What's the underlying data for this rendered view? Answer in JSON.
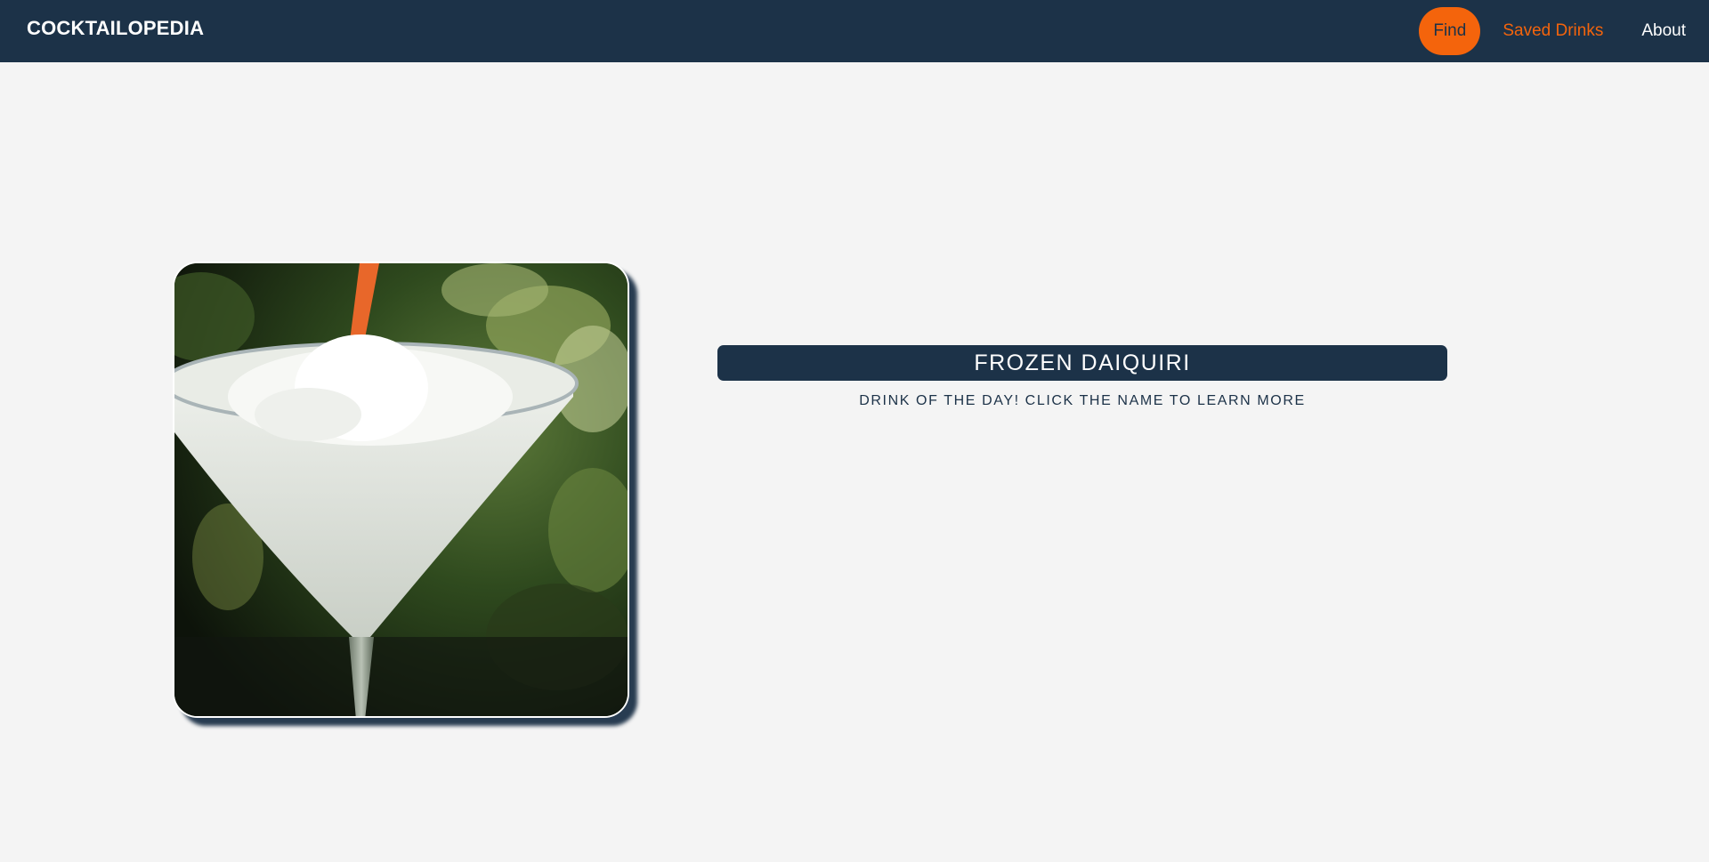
{
  "header": {
    "brand": "COCKTAILOPEDIA",
    "nav": {
      "find": "Find",
      "saved": "Saved Drinks",
      "about": "About"
    }
  },
  "featured": {
    "title": "FROZEN DAIQUIRI",
    "subtitle": "DRINK OF THE DAY! CLICK THE NAME TO LEARN MORE",
    "image_icon": "frozen-daiquiri-photo"
  },
  "colors": {
    "navy": "#1c3248",
    "accent_orange": "#f4640c",
    "background": "#f4f4f4"
  }
}
